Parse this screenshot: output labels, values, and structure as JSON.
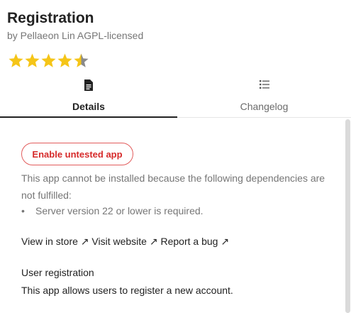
{
  "app": {
    "title": "Registration",
    "subtitle": "by Pellaeon Lin AGPL-licensed",
    "rating": 4.5,
    "rating_max": 5,
    "star_color": "#f5c518",
    "star_empty_color": "#8a8a8a"
  },
  "tabs": [
    {
      "label": "Details",
      "icon": "document-icon",
      "active": true
    },
    {
      "label": "Changelog",
      "icon": "list-icon",
      "active": false
    }
  ],
  "details": {
    "enable_button_label": "Enable untested app",
    "warning_text": "This app cannot be installed because the following dependencies are not fulfilled:",
    "dependency_bullet": "•",
    "dependencies": [
      "Server version 22 or lower is required."
    ],
    "links": [
      {
        "label": "View in store ↗"
      },
      {
        "label": "Visit website ↗"
      },
      {
        "label": "Report a bug ↗"
      }
    ],
    "description_title": "User registration",
    "description_text": "This app allows users to register a new account."
  },
  "colors": {
    "danger": "#d62a2a",
    "muted_text": "#767676",
    "active_tab_underline": "#222222"
  }
}
